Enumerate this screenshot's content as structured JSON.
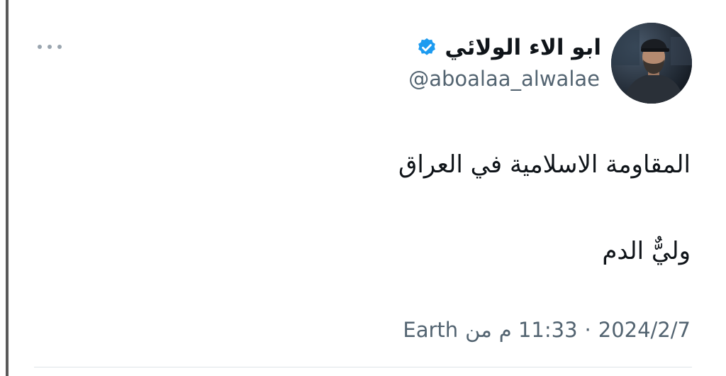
{
  "tweet": {
    "author": {
      "display_name": "ابو الاء الولائي",
      "handle": "@aboalaa_alwalae",
      "verified": true,
      "avatar_icon": "profile-photo-man-icon"
    },
    "text_lines": [
      "المقاومة الاسلامية في العراق",
      "وليٌّ الدم"
    ],
    "meta": {
      "date": "2024/2/7",
      "separator": "·",
      "time": "11:33 م",
      "source_prefix": "من",
      "source": "Earth"
    },
    "more_icon": "more-horizontal-icon"
  },
  "colors": {
    "text_primary": "#0f1419",
    "text_secondary": "#536471",
    "verified_blue": "#1d9bf0",
    "divider": "#dfe4e8",
    "left_rule": "#5a5a5a"
  }
}
